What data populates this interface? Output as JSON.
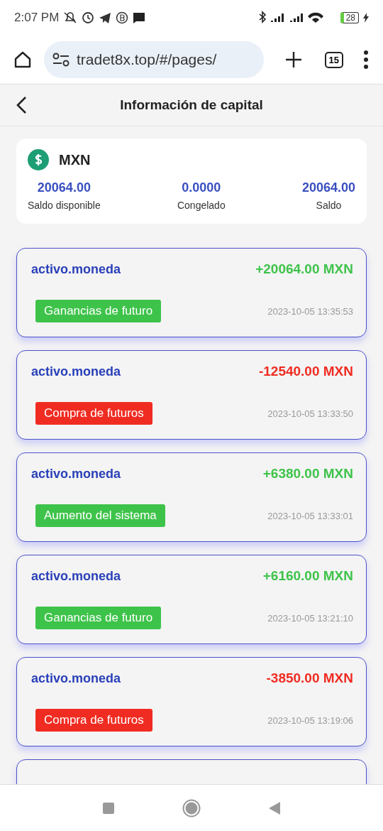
{
  "status_bar": {
    "time": "2:07 PM",
    "battery": "28"
  },
  "browser": {
    "url": "tradet8x.top/#/pages/",
    "tab_count": "15"
  },
  "header": {
    "title": "Información de capital"
  },
  "summary": {
    "currency": "MXN",
    "stats": [
      {
        "value": "20064.00",
        "label": "Saldo disponible"
      },
      {
        "value": "0.0000",
        "label": "Congelado"
      },
      {
        "value": "20064.00",
        "label": "Saldo"
      }
    ]
  },
  "records": [
    {
      "title": "activo.moneda",
      "amount": "+20064.00 MXN",
      "tag": "Ganancias de futuro",
      "time": "2023-10-05 13:35:53",
      "kind": "credit"
    },
    {
      "title": "activo.moneda",
      "amount": "-12540.00 MXN",
      "tag": "Compra de futuros",
      "time": "2023-10-05 13:33:50",
      "kind": "debit"
    },
    {
      "title": "activo.moneda",
      "amount": "+6380.00 MXN",
      "tag": "Aumento del sistema",
      "time": "2023-10-05 13:33:01",
      "kind": "credit"
    },
    {
      "title": "activo.moneda",
      "amount": "+6160.00 MXN",
      "tag": "Ganancias de futuro",
      "time": "2023-10-05 13:21:10",
      "kind": "credit"
    },
    {
      "title": "activo.moneda",
      "amount": "-3850.00 MXN",
      "tag": "Compra de futuros",
      "time": "2023-10-05 13:19:06",
      "kind": "debit"
    }
  ]
}
